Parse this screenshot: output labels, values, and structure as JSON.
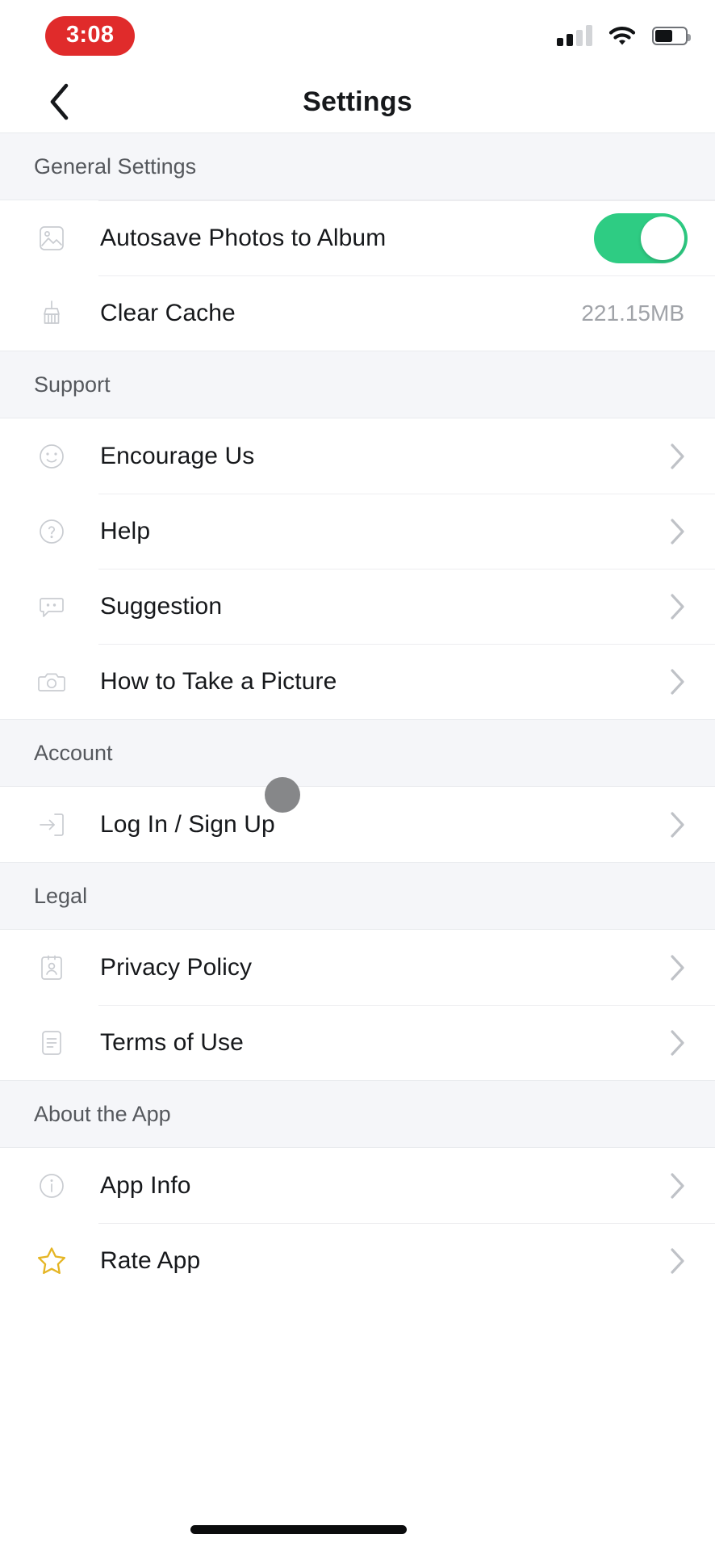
{
  "status_bar": {
    "time": "3:08",
    "time_pill_color": "#E02B2B",
    "signal_icon": "cellular-signal-icon",
    "signal_bars_filled": 2,
    "signal_bars_total": 4,
    "wifi_icon": "wifi-icon",
    "battery_icon": "battery-icon",
    "battery_level_percent": 55
  },
  "navbar": {
    "back_icon": "back-chevron-icon",
    "title": "Settings"
  },
  "sections": [
    {
      "header": "General Settings",
      "rows": [
        {
          "icon": "photo-image-icon",
          "label": "Autosave Photos to Album",
          "control": "toggle",
          "toggle_on": true,
          "toggle_color": "#2ECC83"
        },
        {
          "icon": "broom-brush-icon",
          "label": "Clear Cache",
          "control": "value",
          "value": "221.15MB"
        }
      ]
    },
    {
      "header": "Support",
      "rows": [
        {
          "icon": "smiley-face-icon",
          "label": "Encourage Us",
          "control": "chevron"
        },
        {
          "icon": "question-mark-circle-icon",
          "label": "Help",
          "control": "chevron"
        },
        {
          "icon": "speech-bubble-icon",
          "label": "Suggestion",
          "control": "chevron"
        },
        {
          "icon": "camera-icon",
          "label": "How to Take a Picture",
          "control": "chevron"
        }
      ]
    },
    {
      "header": "Account",
      "rows": [
        {
          "icon": "login-arrow-icon",
          "label": "Log In / Sign Up",
          "control": "chevron"
        }
      ]
    },
    {
      "header": "Legal",
      "rows": [
        {
          "icon": "id-card-icon",
          "label": "Privacy Policy",
          "control": "chevron"
        },
        {
          "icon": "document-lines-icon",
          "label": "Terms of Use",
          "control": "chevron"
        }
      ]
    },
    {
      "header": "About the App",
      "rows": [
        {
          "icon": "info-circle-icon",
          "label": "App Info",
          "control": "chevron"
        },
        {
          "icon": "star-outline-icon",
          "label": "Rate App",
          "control": "chevron",
          "icon_color": "#E5B524"
        }
      ]
    }
  ],
  "overlays": {
    "touch_indicator": "touch-point-indicator",
    "home_indicator": "home-indicator-bar"
  }
}
